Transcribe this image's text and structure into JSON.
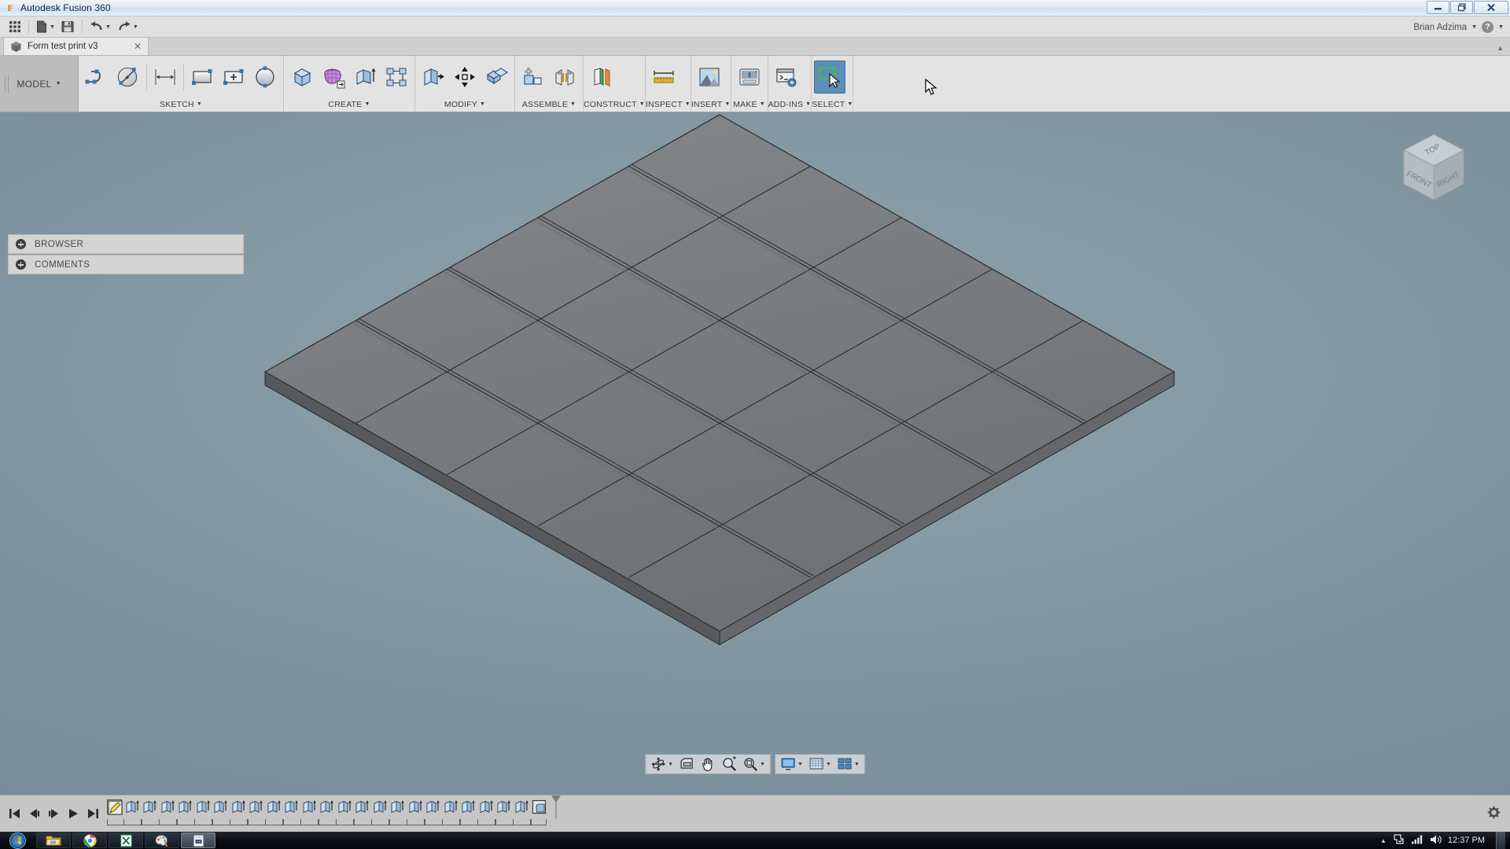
{
  "window": {
    "app_title": "Autodesk Fusion 360",
    "app_icon": "fusion-f-icon",
    "minimize_label": "—",
    "restore_label": "❐",
    "close_label": "✕"
  },
  "quick_access": {
    "grid_icon": "app-grid-icon",
    "new_icon": "new-document-icon",
    "save_icon": "save-icon",
    "undo_icon": "undo-arrow-icon",
    "redo_icon": "redo-arrow-icon",
    "user_name": "Brian Adzima",
    "help_label": "?"
  },
  "document_tab": {
    "label": "Form test print v3",
    "icon": "document-cube-icon",
    "close_label": "✕",
    "collapse_label": "▲"
  },
  "ribbon": {
    "workspace": "MODEL",
    "panels": [
      {
        "label": "SKETCH",
        "tools": [
          {
            "name": "sketch-line-icon"
          },
          {
            "name": "sketch-circle-icon"
          },
          {
            "name": "sketch-dimension-icon"
          },
          {
            "name": "sketch-rectangle-icon"
          },
          {
            "name": "sketch-create-icon"
          },
          {
            "name": "sketch-stop-icon"
          }
        ]
      },
      {
        "label": "CREATE",
        "tools": [
          {
            "name": "create-box-icon"
          },
          {
            "name": "create-form-icon"
          },
          {
            "name": "create-extrude-icon"
          },
          {
            "name": "create-pattern-icon"
          }
        ]
      },
      {
        "label": "MODIFY",
        "tools": [
          {
            "name": "modify-press-pull-icon"
          },
          {
            "name": "modify-move-icon"
          },
          {
            "name": "modify-combine-icon"
          }
        ]
      },
      {
        "label": "ASSEMBLE",
        "tools": [
          {
            "name": "assemble-new-component-icon"
          },
          {
            "name": "assemble-joint-icon"
          }
        ]
      },
      {
        "label": "CONSTRUCT",
        "tools": [
          {
            "name": "construct-offset-plane-icon"
          }
        ]
      },
      {
        "label": "INSPECT",
        "tools": [
          {
            "name": "inspect-measure-icon"
          }
        ]
      },
      {
        "label": "INSERT",
        "tools": [
          {
            "name": "insert-image-icon"
          }
        ]
      },
      {
        "label": "MAKE",
        "tools": [
          {
            "name": "make-3d-print-icon"
          }
        ]
      },
      {
        "label": "ADD-INS",
        "tools": [
          {
            "name": "addins-scripts-icon"
          }
        ]
      },
      {
        "label": "SELECT",
        "tools": [
          {
            "name": "select-window-icon",
            "active": true
          }
        ]
      }
    ]
  },
  "left_panel": {
    "items": [
      {
        "label": "BROWSER",
        "expand_icon": "plus-circle-icon"
      },
      {
        "label": "COMMENTS",
        "expand_icon": "plus-circle-icon"
      }
    ]
  },
  "viewcube": {
    "top_face": "TOP",
    "front_face": "FRONT",
    "right_face": "RIGHT"
  },
  "model": {
    "description": "Grid of square tiles plate in isometric view",
    "rows": 5,
    "cols": 5,
    "body_color": "#76797c",
    "edge_color": "#2a2c2e"
  },
  "navigation_bar": {
    "groups": [
      {
        "buttons": [
          {
            "name": "orbit-icon",
            "has_caret": true
          },
          {
            "name": "look-at-icon",
            "has_caret": false
          },
          {
            "name": "pan-hand-icon",
            "has_caret": false
          },
          {
            "name": "zoom-magnifier-icon",
            "has_caret": false
          },
          {
            "name": "fit-view-icon",
            "has_caret": true
          }
        ]
      },
      {
        "buttons": [
          {
            "name": "display-settings-icon",
            "has_caret": true
          },
          {
            "name": "grid-snaps-icon",
            "has_caret": true
          },
          {
            "name": "viewport-layout-icon",
            "has_caret": true
          }
        ]
      }
    ]
  },
  "timeline": {
    "playback": [
      {
        "name": "timeline-skip-start-icon"
      },
      {
        "name": "timeline-step-back-icon"
      },
      {
        "name": "timeline-step-forward-icon"
      },
      {
        "name": "timeline-play-icon"
      },
      {
        "name": "timeline-skip-end-icon"
      }
    ],
    "features": [
      {
        "name": "timeline-sketch-feature",
        "type": "sketch"
      },
      {
        "name": "timeline-extrude-feature",
        "type": "extrude"
      },
      {
        "name": "timeline-extrude-feature",
        "type": "extrude"
      },
      {
        "name": "timeline-extrude-feature",
        "type": "extrude"
      },
      {
        "name": "timeline-extrude-feature",
        "type": "extrude"
      },
      {
        "name": "timeline-extrude-feature",
        "type": "extrude"
      },
      {
        "name": "timeline-extrude-feature",
        "type": "extrude"
      },
      {
        "name": "timeline-extrude-feature",
        "type": "extrude"
      },
      {
        "name": "timeline-extrude-feature",
        "type": "extrude"
      },
      {
        "name": "timeline-extrude-feature",
        "type": "extrude"
      },
      {
        "name": "timeline-extrude-feature",
        "type": "extrude"
      },
      {
        "name": "timeline-extrude-feature",
        "type": "extrude"
      },
      {
        "name": "timeline-extrude-feature",
        "type": "extrude"
      },
      {
        "name": "timeline-extrude-feature",
        "type": "extrude"
      },
      {
        "name": "timeline-extrude-feature",
        "type": "extrude"
      },
      {
        "name": "timeline-extrude-feature",
        "type": "extrude"
      },
      {
        "name": "timeline-extrude-feature",
        "type": "extrude"
      },
      {
        "name": "timeline-extrude-feature",
        "type": "extrude"
      },
      {
        "name": "timeline-extrude-feature",
        "type": "extrude"
      },
      {
        "name": "timeline-extrude-feature",
        "type": "extrude"
      },
      {
        "name": "timeline-extrude-feature",
        "type": "extrude"
      },
      {
        "name": "timeline-extrude-feature",
        "type": "extrude"
      },
      {
        "name": "timeline-extrude-feature",
        "type": "extrude"
      },
      {
        "name": "timeline-extrude-feature",
        "type": "extrude"
      },
      {
        "name": "timeline-fillet-feature",
        "type": "fillet"
      }
    ],
    "settings_icon": "timeline-settings-gear-icon"
  },
  "taskbar": {
    "start_label": "Start",
    "items": [
      {
        "name": "taskbar-explorer",
        "active": false
      },
      {
        "name": "taskbar-chrome",
        "active": false
      },
      {
        "name": "taskbar-excel",
        "active": false
      },
      {
        "name": "taskbar-paint",
        "active": false
      },
      {
        "name": "taskbar-app",
        "active": true
      }
    ],
    "tray": {
      "arrow": "▲",
      "icons": [
        "tray-action-center-icon",
        "tray-network-icon",
        "tray-volume-icon"
      ],
      "clock": "12:37 PM"
    }
  }
}
